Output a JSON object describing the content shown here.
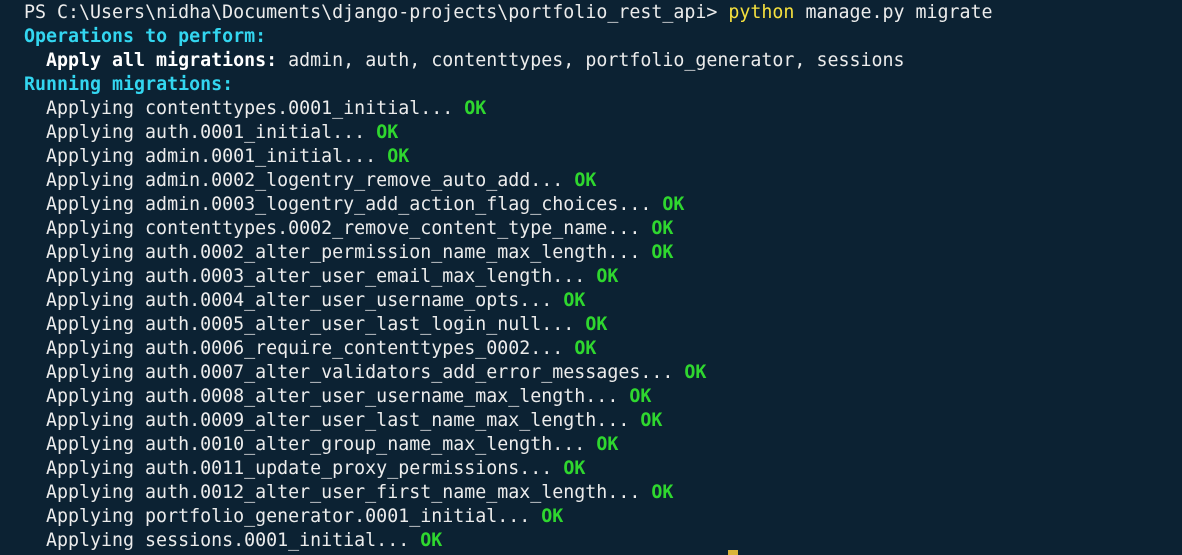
{
  "prompt": {
    "path": "PS C:\\Users\\nidha\\Documents\\django-projects\\portfolio_rest_api> ",
    "command": "python",
    "args": " manage.py migrate"
  },
  "operations": {
    "header": "Operations to perform:",
    "apply_label": "Apply all migrations:",
    "apps": " admin, auth, contenttypes, portfolio_generator, sessions"
  },
  "running_header": "Running migrations:",
  "ok_label": "OK",
  "migrations": [
    "Applying contenttypes.0001_initial...",
    "Applying auth.0001_initial...",
    "Applying admin.0001_initial...",
    "Applying admin.0002_logentry_remove_auto_add...",
    "Applying admin.0003_logentry_add_action_flag_choices...",
    "Applying contenttypes.0002_remove_content_type_name...",
    "Applying auth.0002_alter_permission_name_max_length...",
    "Applying auth.0003_alter_user_email_max_length...",
    "Applying auth.0004_alter_user_username_opts...",
    "Applying auth.0005_alter_user_last_login_null...",
    "Applying auth.0006_require_contenttypes_0002...",
    "Applying auth.0007_alter_validators_add_error_messages...",
    "Applying auth.0008_alter_user_username_max_length...",
    "Applying auth.0009_alter_user_last_name_max_length...",
    "Applying auth.0010_alter_group_name_max_length...",
    "Applying auth.0011_update_proxy_permissions...",
    "Applying auth.0012_alter_user_first_name_max_length...",
    "Applying portfolio_generator.0001_initial...",
    "Applying sessions.0001_initial..."
  ],
  "colors": {
    "background": "#0c2233",
    "command": "#f5e03e",
    "header": "#33d6f0",
    "ok": "#2fd72f"
  }
}
